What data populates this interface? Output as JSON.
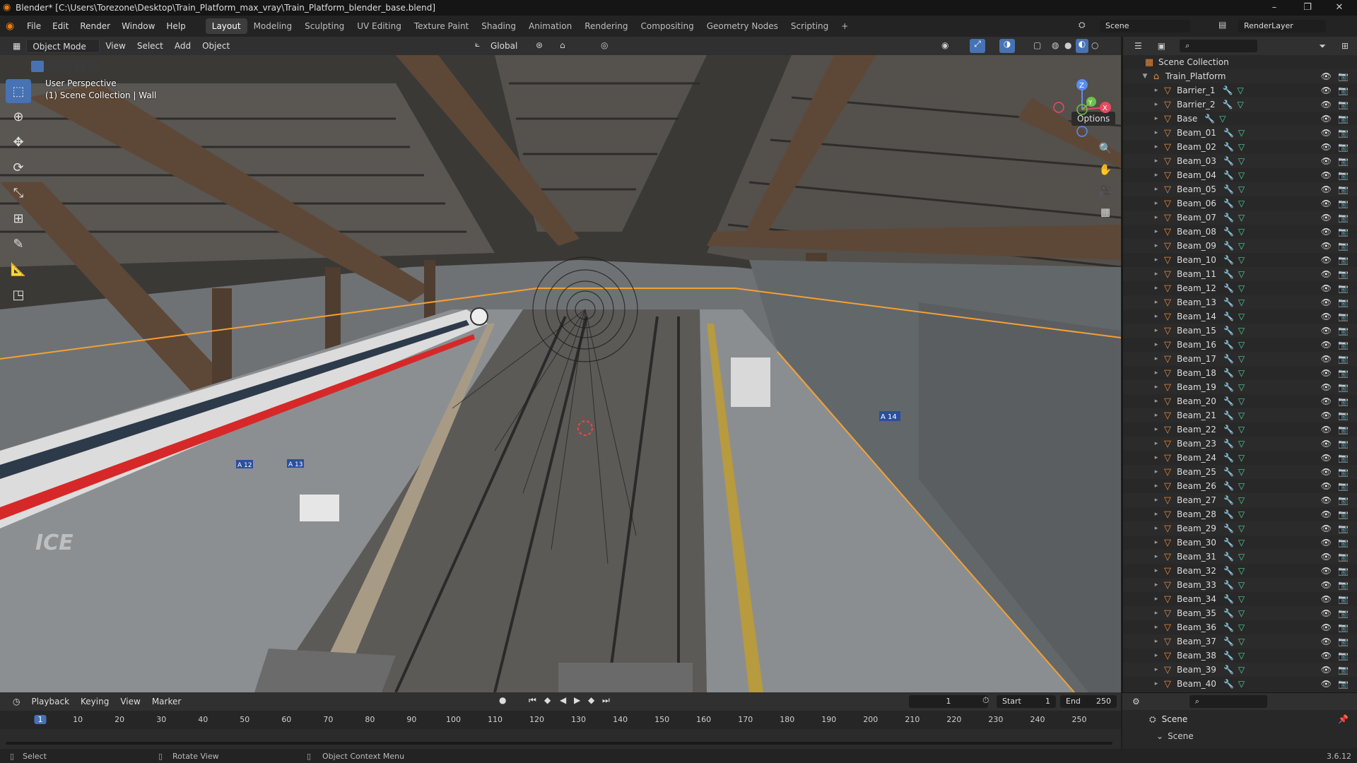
{
  "window": {
    "title": "Blender* [C:\\Users\\Torezone\\Desktop\\Train_Platform_max_vray\\Train_Platform_blender_base.blend]",
    "minimize": "–",
    "maximize": "❐",
    "close": "✕"
  },
  "menu": {
    "items": [
      "File",
      "Edit",
      "Render",
      "Window",
      "Help"
    ],
    "workspaces": [
      "Layout",
      "Modeling",
      "Sculpting",
      "UV Editing",
      "Texture Paint",
      "Shading",
      "Animation",
      "Rendering",
      "Compositing",
      "Geometry Nodes",
      "Scripting"
    ],
    "active_workspace": "Layout",
    "add_tab": "+",
    "scene": "Scene",
    "view_layer": "RenderLayer"
  },
  "viewport_header": {
    "mode": "Object Mode",
    "menus": [
      "View",
      "Select",
      "Add",
      "Object"
    ],
    "transform_orientation": "Global",
    "options": "Options"
  },
  "viewport": {
    "perspective": "User Perspective",
    "collection": "(1) Scene Collection | Wall",
    "gizmo_axes": {
      "z": "Z",
      "y": "Y",
      "x": "X"
    },
    "labels_in_scene": [
      "A 12",
      "A 13",
      "A 14",
      "ICE"
    ]
  },
  "outliner": {
    "root": "Scene Collection",
    "collection": "Train_Platform",
    "objects": [
      "Barrier_1",
      "Barrier_2",
      "Base",
      "Beam_01",
      "Beam_02",
      "Beam_03",
      "Beam_04",
      "Beam_05",
      "Beam_06",
      "Beam_07",
      "Beam_08",
      "Beam_09",
      "Beam_10",
      "Beam_11",
      "Beam_12",
      "Beam_13",
      "Beam_14",
      "Beam_15",
      "Beam_16",
      "Beam_17",
      "Beam_18",
      "Beam_19",
      "Beam_20",
      "Beam_21",
      "Beam_22",
      "Beam_23",
      "Beam_24",
      "Beam_25",
      "Beam_26",
      "Beam_27",
      "Beam_28",
      "Beam_29",
      "Beam_30",
      "Beam_31",
      "Beam_32",
      "Beam_33",
      "Beam_34",
      "Beam_35",
      "Beam_36",
      "Beam_37",
      "Beam_38",
      "Beam_39",
      "Beam_40"
    ]
  },
  "timeline": {
    "menus": [
      "Playback",
      "Keying",
      "View",
      "Marker"
    ],
    "current_frame": "1",
    "start_label": "Start",
    "start": "1",
    "end_label": "End",
    "end": "250",
    "ruler": [
      "1",
      "10",
      "20",
      "30",
      "40",
      "50",
      "60",
      "70",
      "80",
      "90",
      "100",
      "110",
      "120",
      "130",
      "140",
      "150",
      "160",
      "170",
      "180",
      "190",
      "200",
      "210",
      "220",
      "230",
      "240",
      "250"
    ]
  },
  "properties": {
    "scene": "Scene",
    "section": "Scene"
  },
  "status": {
    "select": "Select",
    "rotate": "Rotate View",
    "context": "Object Context Menu",
    "version": "3.6.12"
  },
  "colors": {
    "accent": "#4772b3",
    "selection_outline": "#f5a033",
    "object_icon": "#e8893b",
    "mesh_icon": "#4fd3a0"
  }
}
